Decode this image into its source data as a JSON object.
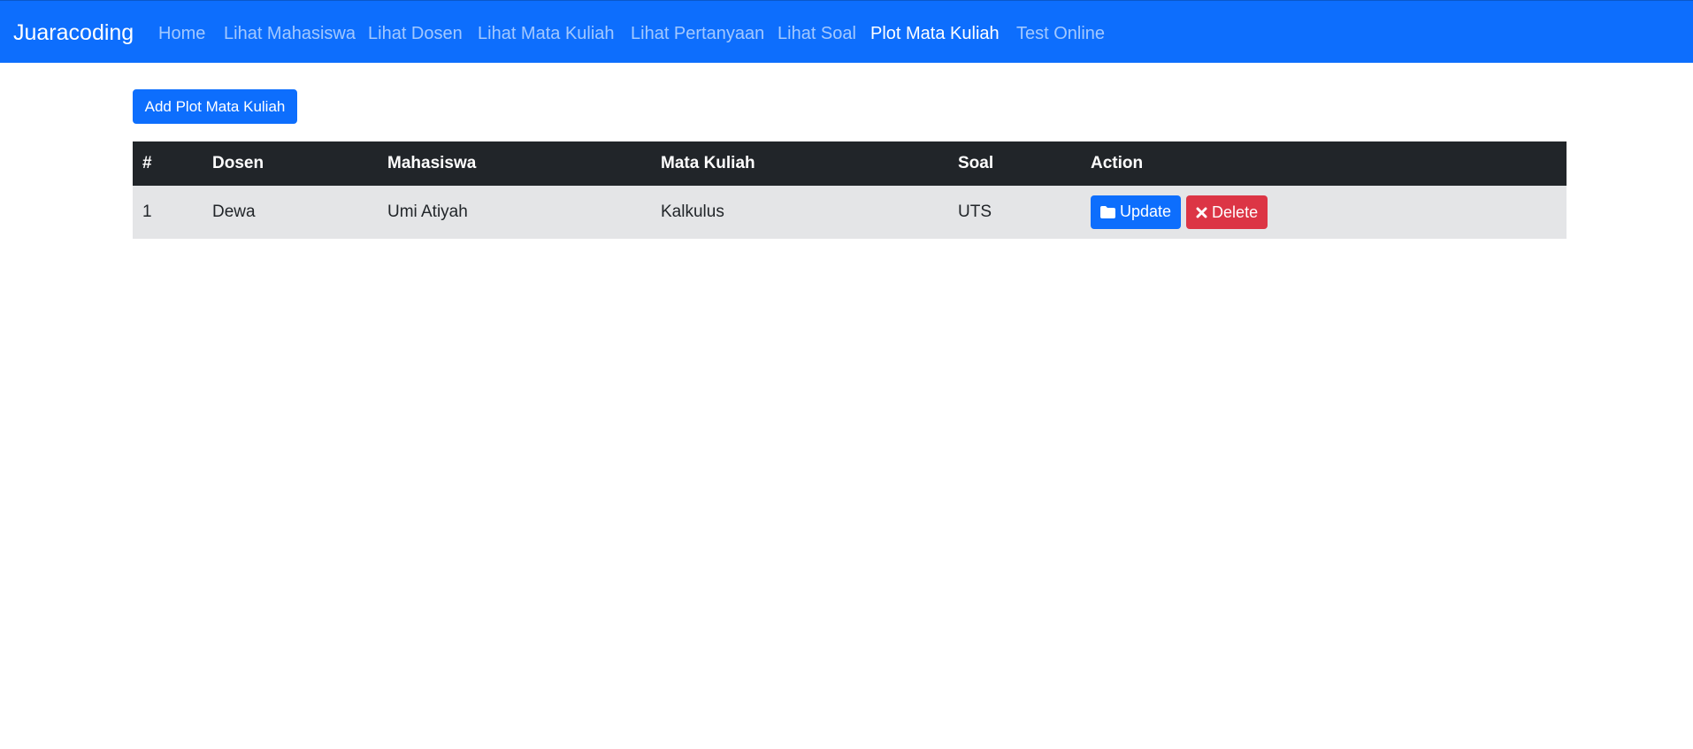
{
  "navbar": {
    "brand": "Juaracoding",
    "links": [
      {
        "label": "Home",
        "active": false
      },
      {
        "label": "Lihat Mahasiswa",
        "active": false
      },
      {
        "label": "Lihat Dosen",
        "active": false
      },
      {
        "label": "Lihat Mata Kuliah",
        "active": false
      },
      {
        "label": "Lihat Pertanyaan",
        "active": false
      },
      {
        "label": "Lihat Soal",
        "active": false
      },
      {
        "label": "Plot Mata Kuliah",
        "active": true
      },
      {
        "label": "Test Online",
        "active": false
      }
    ]
  },
  "main": {
    "add_button_label": "Add Plot Mata Kuliah",
    "table": {
      "headers": [
        "#",
        "Dosen",
        "Mahasiswa",
        "Mata Kuliah",
        "Soal",
        "Action"
      ],
      "rows": [
        {
          "no": "1",
          "dosen": "Dewa",
          "mahasiswa": "Umi Atiyah",
          "mata_kuliah": "Kalkulus",
          "soal": "UTS"
        }
      ],
      "update_label": "Update",
      "delete_label": "Delete",
      "update_icon": "folder-icon",
      "delete_icon": "times-icon"
    }
  },
  "colors": {
    "primary": "#0d6efd",
    "danger": "#dc3545",
    "table_header": "#212529",
    "row_bg": "#e4e5e7"
  }
}
